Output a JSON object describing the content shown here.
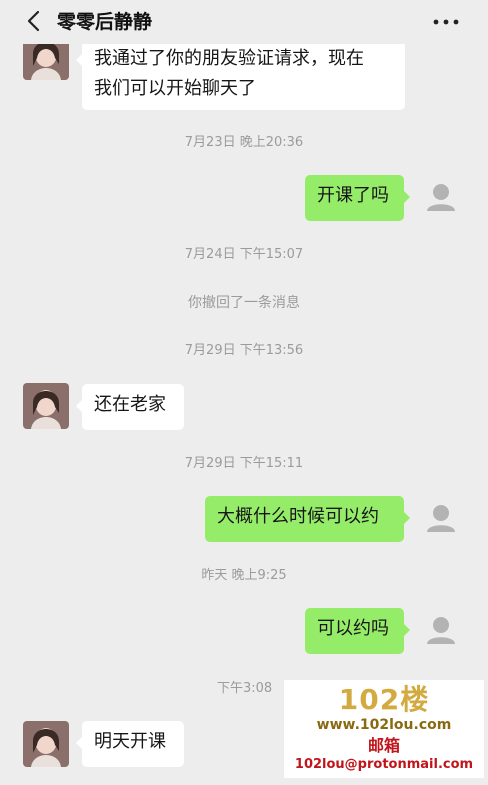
{
  "header": {
    "title": "零零后静静"
  },
  "messages": {
    "m1_line1": "我通过了你的朋友验证请求，现在",
    "m1_line2": "我们可以开始聊天了",
    "t1": "7月23日 晚上20:36",
    "m2": "开课了吗",
    "t2": "7月24日 下午15:07",
    "recall": "你撤回了一条消息",
    "t3": "7月29日 下午13:56",
    "m3": "还在老家",
    "t4": "7月29日 下午15:11",
    "m4": "大概什么时候可以约",
    "t5": "昨天 晚上9:25",
    "m5": "可以约吗",
    "t6": "下午3:08",
    "m6": "明天开课"
  },
  "watermark": {
    "brand": "102楼",
    "url": "www.102lou.com",
    "mail_label": "邮箱",
    "email": "102lou@protonmail.com"
  },
  "colors": {
    "out_bubble": "#95ec69",
    "in_bubble": "#ffffff",
    "background": "#ededed"
  }
}
